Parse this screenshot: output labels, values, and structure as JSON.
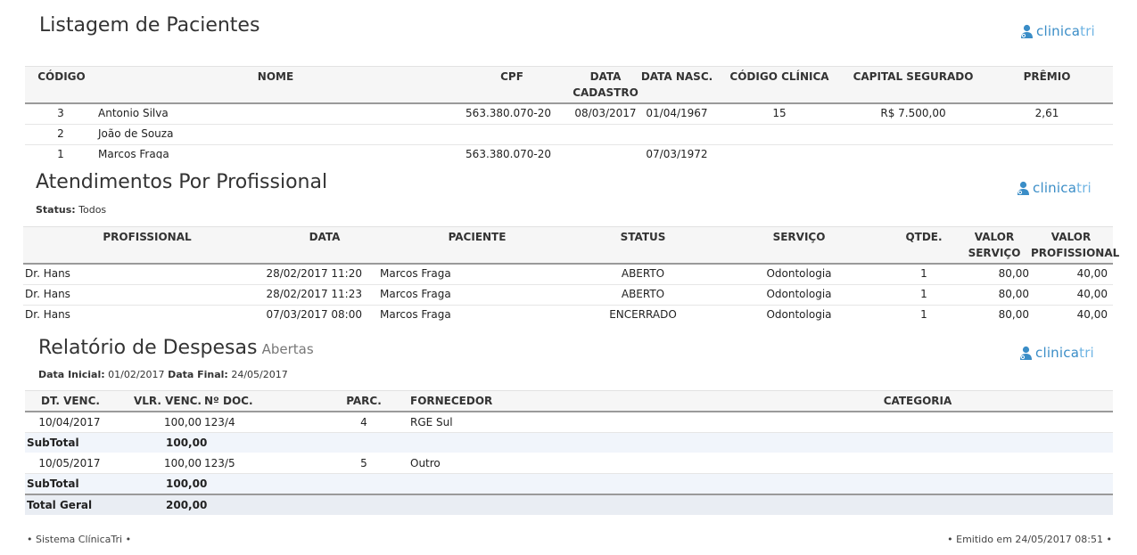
{
  "logo": {
    "brand_bold": "clinica",
    "brand_light": "tri"
  },
  "patients": {
    "title": "Listagem de Pacientes",
    "headers": {
      "codigo": "CÓDIGO",
      "nome": "NOME",
      "cpf": "CPF",
      "data_cad_1": "DATA",
      "data_cad_2": "CADASTRO",
      "data_nasc": "DATA NASC.",
      "codigo_clinica": "CÓDIGO CLÍNICA",
      "capital": "CAPITAL SEGURADO",
      "premio": "PRÊMIO"
    },
    "rows": [
      {
        "codigo": "3",
        "nome": "Antonio Silva",
        "cpf": "563.380.070-20",
        "data_cadastro": "08/03/2017",
        "data_nasc": "01/04/1967",
        "codigo_clinica": "15",
        "capital": "R$ 7.500,00",
        "premio": "2,61"
      },
      {
        "codigo": "2",
        "nome": "João de Souza",
        "cpf": "",
        "data_cadastro": "",
        "data_nasc": "",
        "codigo_clinica": "",
        "capital": "",
        "premio": ""
      },
      {
        "codigo": "1",
        "nome": "Marcos Fraga",
        "cpf": "563.380.070-20",
        "data_cadastro": "",
        "data_nasc": "07/03/1972",
        "codigo_clinica": "",
        "capital": "",
        "premio": ""
      }
    ]
  },
  "atendimentos": {
    "title": "Atendimentos Por Profissional",
    "status_label": "Status:",
    "status_value": "Todos",
    "headers": {
      "profissional": "PROFISSIONAL",
      "data": "DATA",
      "paciente": "PACIENTE",
      "status": "STATUS",
      "servico": "SERVIÇO",
      "qtde": "QTDE.",
      "valor_servico_1": "VALOR",
      "valor_servico_2": "SERVIÇO",
      "valor_prof_1": "VALOR",
      "valor_prof_2": "PROFISSIONAL"
    },
    "rows": [
      {
        "profissional": "Dr. Hans",
        "data": "28/02/2017 11:20",
        "paciente": "Marcos Fraga",
        "status": "ABERTO",
        "servico": "Odontologia",
        "qtde": "1",
        "valor_servico": "80,00",
        "valor_profissional": "40,00"
      },
      {
        "profissional": "Dr. Hans",
        "data": "28/02/2017 11:23",
        "paciente": "Marcos Fraga",
        "status": "ABERTO",
        "servico": "Odontologia",
        "qtde": "1",
        "valor_servico": "80,00",
        "valor_profissional": "40,00"
      },
      {
        "profissional": "Dr. Hans",
        "data": "07/03/2017 08:00",
        "paciente": "Marcos Fraga",
        "status": "ENCERRADO",
        "servico": "Odontologia",
        "qtde": "1",
        "valor_servico": "80,00",
        "valor_profissional": "40,00"
      }
    ]
  },
  "despesas": {
    "title": "Relatório de Despesas",
    "subtitle": "Abertas",
    "data_inicial_label": "Data Inicial:",
    "data_inicial": "01/02/2017",
    "data_final_label": "Data Final:",
    "data_final": "24/05/2017",
    "headers": {
      "dt_venc": "DT. VENC.",
      "vlr_venc": "VLR. VENC.",
      "n_doc": "Nº DOC.",
      "parc": "PARC.",
      "fornecedor": "FORNECEDOR",
      "categoria": "CATEGORIA"
    },
    "rows": [
      {
        "dt_venc": "10/04/2017",
        "vlr_venc": "100,00",
        "n_doc": "123/4",
        "parc": "4",
        "fornecedor": "RGE Sul",
        "categoria": ""
      },
      {
        "dt_venc": "10/05/2017",
        "vlr_venc": "100,00",
        "n_doc": "123/5",
        "parc": "5",
        "fornecedor": "Outro",
        "categoria": ""
      }
    ],
    "subtotal_label": "SubTotal",
    "subtotals": [
      "100,00",
      "100,00"
    ],
    "total_label": "Total Geral",
    "total": "200,00"
  },
  "footer": {
    "left": "• Sistema ClínicaTri •",
    "right": "• Emitido em 24/05/2017 08:51 •"
  }
}
